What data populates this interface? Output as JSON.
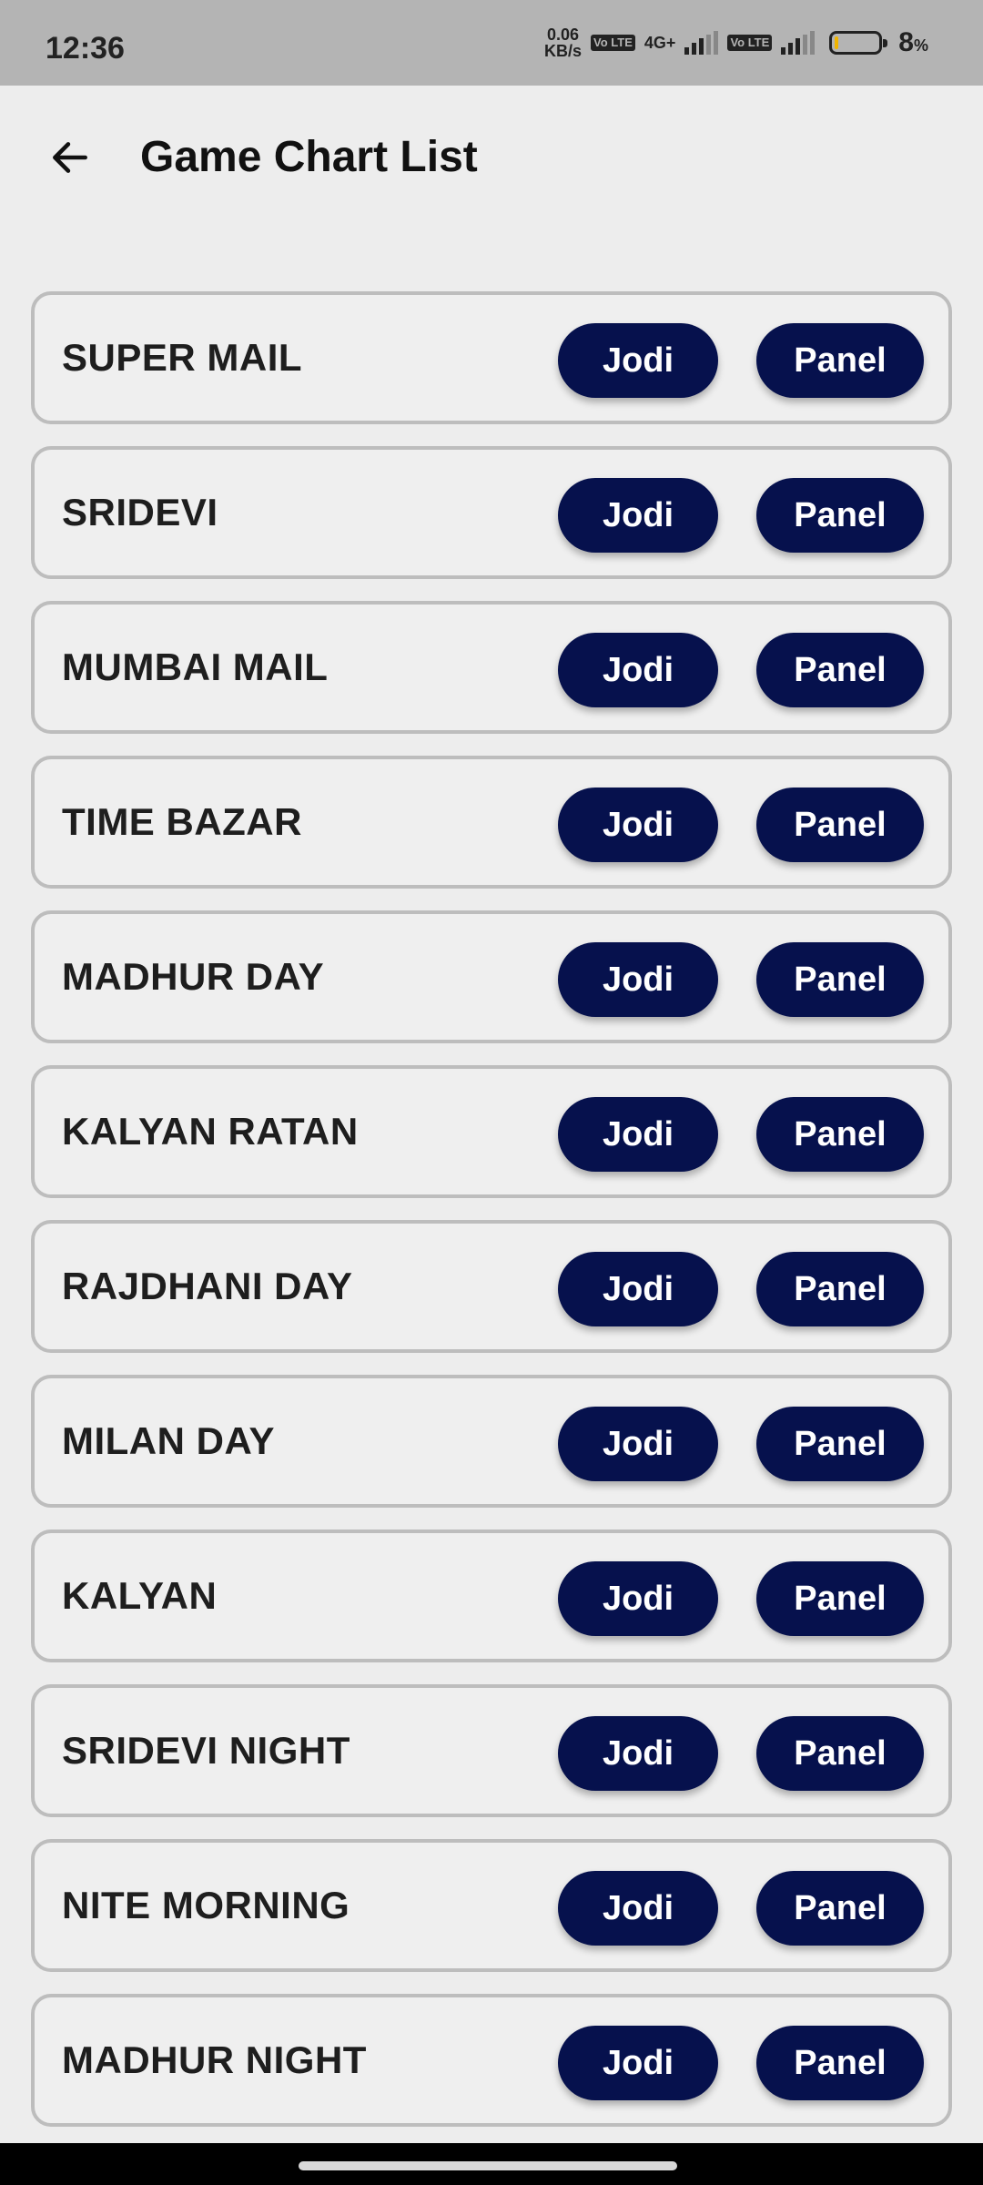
{
  "status_bar": {
    "time": "12:36",
    "net_speed_value": "0.06",
    "net_speed_unit": "KB/s",
    "volte_label_1": "Vo LTE",
    "network_type": "4G+",
    "volte_label_2": "Vo LTE",
    "battery_percent": "8",
    "battery_unit": "%",
    "battery_level": 0.08
  },
  "header": {
    "title": "Game Chart List",
    "back_icon": "arrow-left-icon"
  },
  "games": [
    {
      "name": "SUPER MAIL",
      "jodi_label": "Jodi",
      "panel_label": "Panel"
    },
    {
      "name": "SRIDEVI",
      "jodi_label": "Jodi",
      "panel_label": "Panel"
    },
    {
      "name": "MUMBAI MAIL",
      "jodi_label": "Jodi",
      "panel_label": "Panel"
    },
    {
      "name": "TIME BAZAR",
      "jodi_label": "Jodi",
      "panel_label": "Panel"
    },
    {
      "name": "MADHUR DAY",
      "jodi_label": "Jodi",
      "panel_label": "Panel"
    },
    {
      "name": "KALYAN RATAN",
      "jodi_label": "Jodi",
      "panel_label": "Panel"
    },
    {
      "name": "RAJDHANI DAY",
      "jodi_label": "Jodi",
      "panel_label": "Panel"
    },
    {
      "name": "MILAN DAY",
      "jodi_label": "Jodi",
      "panel_label": "Panel"
    },
    {
      "name": "KALYAN",
      "jodi_label": "Jodi",
      "panel_label": "Panel"
    },
    {
      "name": "SRIDEVI NIGHT",
      "jodi_label": "Jodi",
      "panel_label": "Panel"
    },
    {
      "name": "NITE MORNING",
      "jodi_label": "Jodi",
      "panel_label": "Panel"
    },
    {
      "name": "MADHUR NIGHT",
      "jodi_label": "Jodi",
      "panel_label": "Panel"
    }
  ],
  "colors": {
    "button_bg": "#06114d",
    "button_text": "#ffffff",
    "row_border": "#bdbdbd",
    "background": "#ededed"
  }
}
